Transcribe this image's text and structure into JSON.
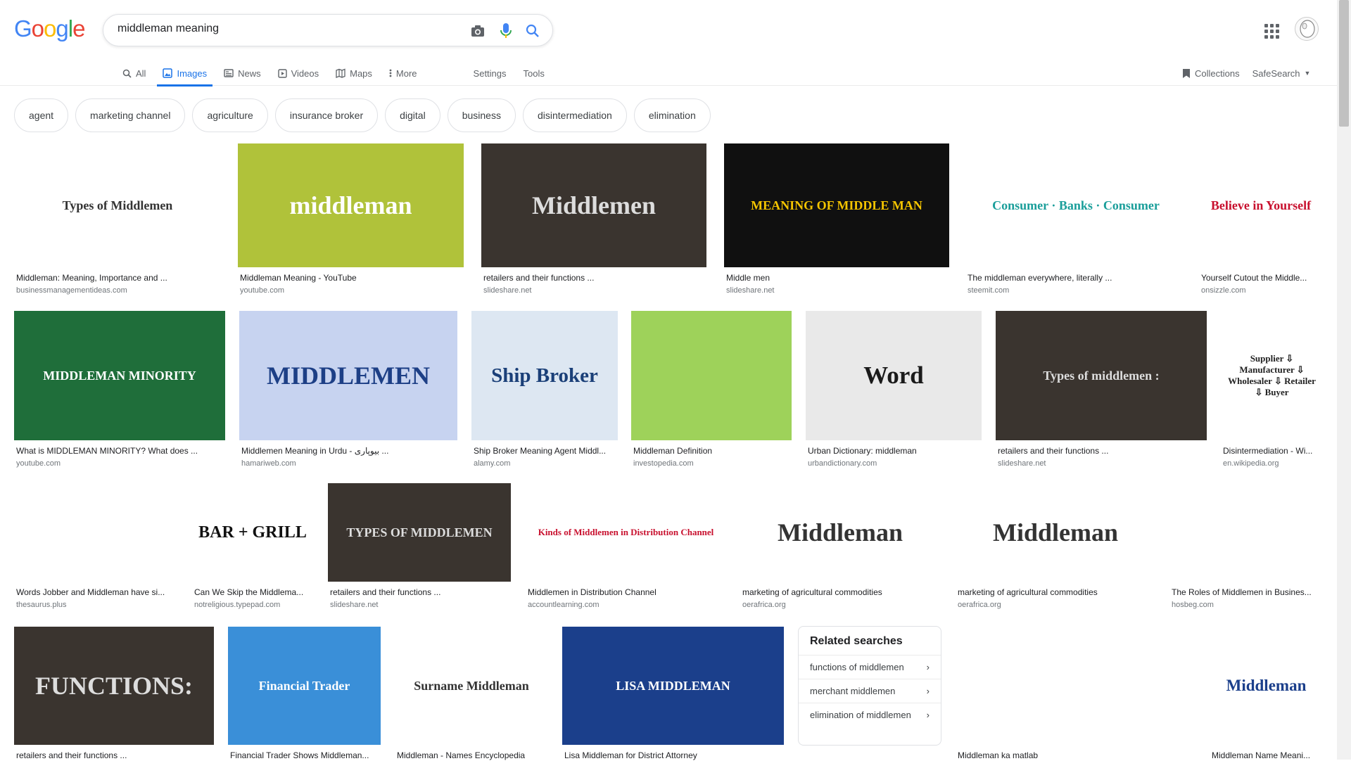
{
  "logo": {
    "letters": [
      "G",
      "o",
      "o",
      "g",
      "l",
      "e"
    ],
    "colors": [
      "#4285F4",
      "#EA4335",
      "#FBBC05",
      "#4285F4",
      "#34A853",
      "#EA4335"
    ]
  },
  "search": {
    "query": "middleman meaning"
  },
  "tabs": [
    {
      "label": "All",
      "icon": "search-icon"
    },
    {
      "label": "Images",
      "icon": "image-icon"
    },
    {
      "label": "News",
      "icon": "news-icon"
    },
    {
      "label": "Videos",
      "icon": "video-icon"
    },
    {
      "label": "Maps",
      "icon": "map-icon"
    },
    {
      "label": "More",
      "icon": "more-vert-icon"
    }
  ],
  "settings_label": "Settings",
  "tools_label": "Tools",
  "collections_label": "Collections",
  "safesearch_label": "SafeSearch",
  "chips": [
    "agent",
    "marketing channel",
    "agriculture",
    "insurance broker",
    "digital",
    "business",
    "disintermediation",
    "elimination"
  ],
  "results": [
    {
      "caption": "Middleman: Meaning, Importance and ...",
      "source": "businessmanagementideas.com",
      "thumb_text": "Types of Middlemen",
      "bg": "#ffffff",
      "fg": "#333333"
    },
    {
      "caption": "Middleman Meaning - YouTube",
      "source": "youtube.com",
      "thumb_text": "middleman",
      "bg": "#b0c23a",
      "fg": "#ffffff"
    },
    {
      "caption": "retailers and their functions ...",
      "source": "slideshare.net",
      "thumb_text": "Middlemen",
      "bg": "#3a342f",
      "fg": "#dddddd"
    },
    {
      "caption": "Middle men",
      "source": "slideshare.net",
      "thumb_text": "MEANING OF MIDDLE MAN",
      "bg": "#101010",
      "fg": "#f4c400"
    },
    {
      "caption": "The middleman everywhere, literally ...",
      "source": "steemit.com",
      "thumb_text": "Consumer · Banks · Consumer",
      "bg": "#ffffff",
      "fg": "#1a9e9a"
    },
    {
      "caption": "Yourself Cutout the Middle...",
      "source": "onsizzle.com",
      "thumb_text": "Believe in Yourself",
      "bg": "#ffffff",
      "fg": "#c8102e"
    },
    {
      "caption": "What is MIDDLEMAN MINORITY? What does ...",
      "source": "youtube.com",
      "thumb_text": "MIDDLEMAN MINORITY",
      "bg": "#1f6e3a",
      "fg": "#ffffff"
    },
    {
      "caption": "Middlemen Meaning in Urdu - بیوپاری ...",
      "source": "hamariweb.com",
      "thumb_text": "MIDDLEMEN",
      "bg": "#c7d3f0",
      "fg": "#1d3f86"
    },
    {
      "caption": "Ship Broker Meaning Agent Middl...",
      "source": "alamy.com",
      "thumb_text": "Ship Broker",
      "bg": "#dde7f2",
      "fg": "#1a3f78"
    },
    {
      "caption": "Middleman Definition",
      "source": "investopedia.com",
      "thumb_text": "",
      "bg": "#9ed25a",
      "fg": "#ffffff"
    },
    {
      "caption": "Urban Dictionary: middleman",
      "source": "urbandictionary.com",
      "thumb_text": "Word",
      "bg": "#e9e9e9",
      "fg": "#1a1a1a"
    },
    {
      "caption": "retailers and their functions ...",
      "source": "slideshare.net",
      "thumb_text": "Types of middlemen :",
      "bg": "#3a342f",
      "fg": "#dddddd"
    },
    {
      "caption": "Disintermediation - Wi...",
      "source": "en.wikipedia.org",
      "thumb_text": "Supplier ⇩ Manufacturer ⇩ Wholesaler ⇩ Retailer ⇩ Buyer",
      "bg": "#ffffff",
      "fg": "#222222"
    },
    {
      "caption": "Words Jobber and Middleman have si...",
      "source": "thesaurus.plus",
      "thumb_text": "",
      "bg": "#ffffff",
      "fg": "#333333"
    },
    {
      "caption": "Can We Skip the Middlema...",
      "source": "notreligious.typepad.com",
      "thumb_text": "BAR + GRILL",
      "bg": "#ffffff",
      "fg": "#111111"
    },
    {
      "caption": "retailers and their functions ...",
      "source": "slideshare.net",
      "thumb_text": "TYPES OF MIDDLEMEN",
      "bg": "#3a342f",
      "fg": "#dddddd"
    },
    {
      "caption": "Middlemen in Distribution Channel",
      "source": "accountlearning.com",
      "thumb_text": "Kinds of Middlemen in Distribution Channel",
      "bg": "#ffffff",
      "fg": "#c8102e"
    },
    {
      "caption": "marketing of agricultural commodities",
      "source": "oerafrica.org",
      "thumb_text": "Middleman",
      "bg": "#ffffff",
      "fg": "#333333"
    },
    {
      "caption": "marketing of agricultural commodities",
      "source": "oerafrica.org",
      "thumb_text": "Middleman",
      "bg": "#ffffff",
      "fg": "#333333"
    },
    {
      "caption": "The Roles of Middlemen in Busines...",
      "source": "hosbeg.com",
      "thumb_text": "",
      "bg": "#ffffff",
      "fg": "#d32f2f"
    },
    {
      "caption": "retailers and their functions ...",
      "source": "",
      "thumb_text": "FUNCTIONS:",
      "bg": "#3a342f",
      "fg": "#dddddd"
    },
    {
      "caption": "Financial Trader Shows Middleman...",
      "source": "",
      "thumb_text": "Financial Trader",
      "bg": "#3a8fd8",
      "fg": "#ffffff"
    },
    {
      "caption": "Middleman - Names Encyclopedia",
      "source": "",
      "thumb_text": "Surname Middleman",
      "bg": "#ffffff",
      "fg": "#333333"
    },
    {
      "caption": "Lisa Middleman for District Attorney",
      "source": "",
      "thumb_text": "LISA MIDDLEMAN",
      "bg": "#1b3f8b",
      "fg": "#ffffff"
    },
    {
      "caption": "Middleman ka matlab",
      "source": "",
      "thumb_text": "",
      "bg": "#ffffff",
      "fg": "#4a7fd4"
    },
    {
      "caption": "Middleman Name Meani...",
      "source": "",
      "thumb_text": "Middleman",
      "bg": "#ffffff",
      "fg": "#1b3f8b"
    }
  ],
  "related": {
    "title": "Related searches",
    "items": [
      "functions of middlemen",
      "merchant middlemen",
      "elimination of middlemen"
    ]
  }
}
